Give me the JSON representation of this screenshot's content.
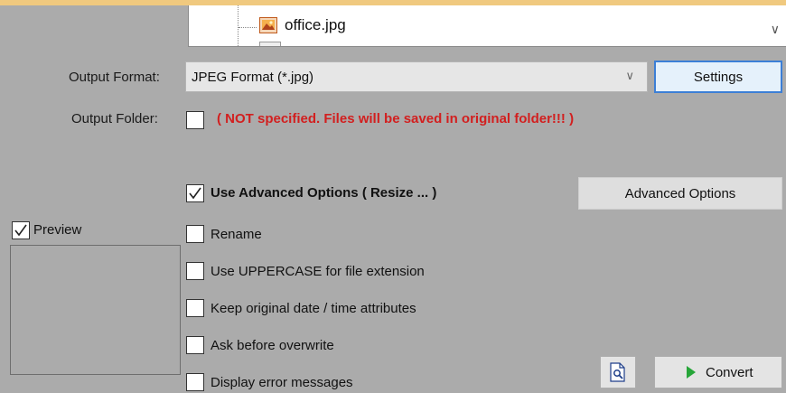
{
  "colors": {
    "accent": "#3c7fd6",
    "warning": "#d21f1f",
    "convert_arrow": "#27a639",
    "background": "#ababab"
  },
  "tree": {
    "file_name": "office.jpg",
    "file_icon": "image-file-icon"
  },
  "output_format": {
    "label": "Output Format:",
    "value": "JPEG Format (*.jpg)",
    "settings_label": "Settings"
  },
  "output_folder": {
    "label": "Output Folder:",
    "checked": false,
    "warning": "( NOT specified.  Files will be saved in original folder!!! )"
  },
  "advanced": {
    "label": "Use Advanced Options ( Resize ... )",
    "checked": true,
    "button_label": "Advanced Options"
  },
  "preview": {
    "label": "Preview",
    "checked": true
  },
  "options": [
    {
      "label": "Rename",
      "checked": false
    },
    {
      "label": "Use UPPERCASE for file extension",
      "checked": false
    },
    {
      "label": "Keep original date / time attributes",
      "checked": false
    },
    {
      "label": "Ask before overwrite",
      "checked": false
    },
    {
      "label": "Display error messages",
      "checked": false
    }
  ],
  "actions": {
    "convert_label": "Convert",
    "preview_icon": "document-magnifier-icon",
    "convert_icon": "play-arrow-icon"
  }
}
